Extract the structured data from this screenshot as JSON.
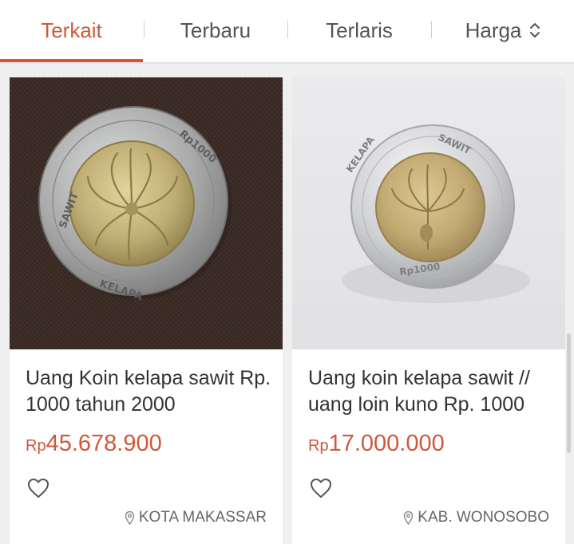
{
  "sort_tabs": {
    "terkait": "Terkait",
    "terbaru": "Terbaru",
    "terlaris": "Terlaris",
    "harga": "Harga"
  },
  "colors": {
    "accent": "#d0583a"
  },
  "products": [
    {
      "title": "Uang Koin kelapa sawit Rp. 1000 tahun 2000",
      "currency": "Rp",
      "amount": "45.678.900",
      "location": "KOTA MAKASSAR",
      "image": "coin-on-brown-fabric"
    },
    {
      "title": "Uang koin kelapa sawit // uang loin kuno Rp. 1000",
      "currency": "Rp",
      "amount": "17.000.000",
      "location": "KAB. WONOSOBO",
      "image": "coin-on-white"
    }
  ],
  "icons": {
    "sort": "up-down-chevron-icon",
    "favorite": "heart-outline-icon",
    "location": "map-pin-icon"
  }
}
